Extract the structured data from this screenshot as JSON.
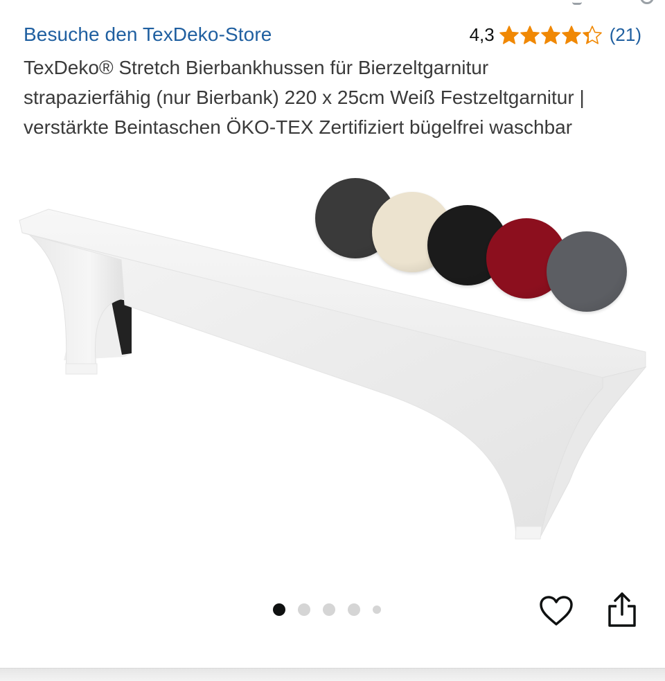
{
  "store": {
    "link_text": "Besuche den TexDeko-Store"
  },
  "rating": {
    "value_text": "4,3",
    "value": 4.3,
    "max": 5,
    "count_text": "(21)",
    "star_color": "#f08804"
  },
  "product": {
    "title": "TexDeko® Stretch Bierbankhussen für Bierzeltgarnitur strapazierfähig (nur Bierbank) 220 x 25cm Weiß Festzeltgarnitur | verstärkte Beintaschen ÖKO-TEX Zertifiziert bügelfrei waschbar"
  },
  "swatches": [
    {
      "name": "dark-gray",
      "color": "#3a3a3a"
    },
    {
      "name": "cream",
      "color": "#ece3cf"
    },
    {
      "name": "black",
      "color": "#1b1b1b"
    },
    {
      "name": "bordeaux",
      "color": "#8c0f1e"
    },
    {
      "name": "gray",
      "color": "#5c5e63"
    }
  ],
  "carousel": {
    "total": 5,
    "active_index": 0
  },
  "actions": {
    "favorite_icon": "heart-icon",
    "share_icon": "share-icon"
  },
  "colors": {
    "link": "#1f5fa0",
    "text": "#0f1111",
    "title_text": "#3a3a3a"
  }
}
